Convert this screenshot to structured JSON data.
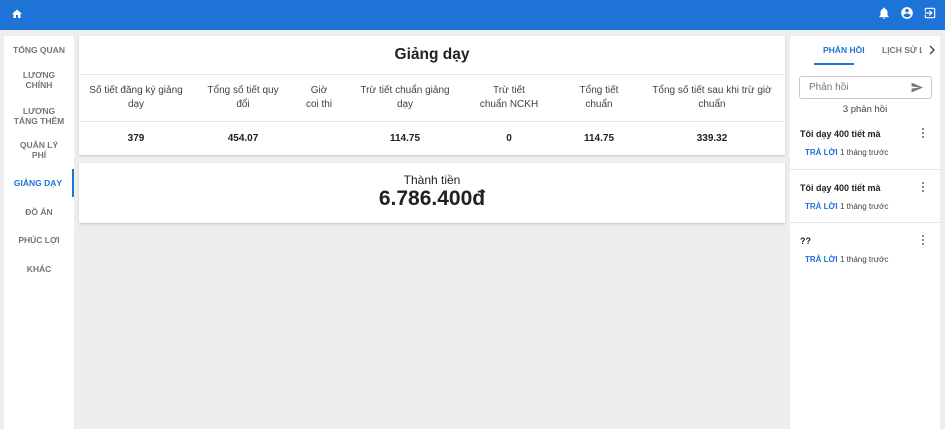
{
  "appbar": {
    "home_icon": "home-icon",
    "right_icons": [
      "bell-icon",
      "account-circle-icon",
      "logout-icon"
    ],
    "color": "#1e73d6"
  },
  "sidebar": {
    "items": [
      {
        "label": "Tổng quan",
        "active": false
      },
      {
        "label": "Lương chính",
        "active": false
      },
      {
        "label": "Lương tăng thêm",
        "active": false
      },
      {
        "label": "Quản lý phí",
        "active": false
      },
      {
        "label": "Giảng dạy",
        "active": true
      },
      {
        "label": "Đồ án",
        "active": false
      },
      {
        "label": "Phúc lợi",
        "active": false
      },
      {
        "label": "Khác",
        "active": false
      }
    ]
  },
  "main": {
    "title": "Giảng dạy",
    "columns": [
      "Số tiết đăng ký giảng dạy",
      "Tổng số tiết quy đổi",
      "Giờ coi thi",
      "Trừ tiết chuẩn giảng dạy",
      "Trừ tiết chuẩn NCKH",
      "Tổng tiết chuẩn",
      "Tổng số tiết sau khi trừ giờ chuẩn"
    ],
    "values": [
      "379",
      "454.07",
      "",
      "114.75",
      "0",
      "114.75",
      "339.32"
    ],
    "total_label": "Thành tiền",
    "total_value": "6.786.400đ"
  },
  "right_panel": {
    "tabs": [
      "Phản hồi",
      "Lịch sử l"
    ],
    "active_tab": 0,
    "input_placeholder": "Phản hồi",
    "count": "3 phản hồi",
    "items": [
      {
        "text": "Tôi dạy 400 tiết mà",
        "reply": "Trả lời",
        "time": "1 tháng trước"
      },
      {
        "text": "Tôi dạy 400 tiết mà",
        "reply": "Trả lời",
        "time": "1 tháng trước"
      },
      {
        "text": "??",
        "reply": "Trả lời",
        "time": "1 tháng trước"
      }
    ]
  }
}
